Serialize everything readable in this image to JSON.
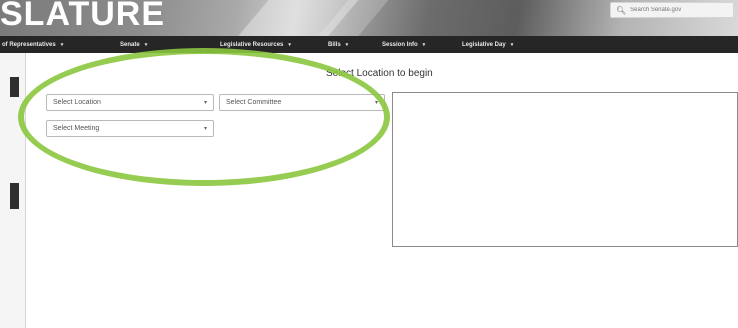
{
  "header": {
    "site_title": "SLATURE",
    "search_placeholder": "Search Senate.gov"
  },
  "nav": {
    "items": [
      {
        "label": "of Representatives"
      },
      {
        "label": "Senate"
      },
      {
        "label": "Legislative Resources"
      },
      {
        "label": "Bills"
      },
      {
        "label": "Session Info"
      },
      {
        "label": "Legislative Day"
      }
    ]
  },
  "main": {
    "prompt": "Select Location to begin",
    "location_select": "Select Location",
    "committee_select": "Select Committee",
    "meeting_select": "Select Meeting"
  },
  "colors": {
    "navbar": "#262626",
    "highlight": "#8cc63f"
  }
}
